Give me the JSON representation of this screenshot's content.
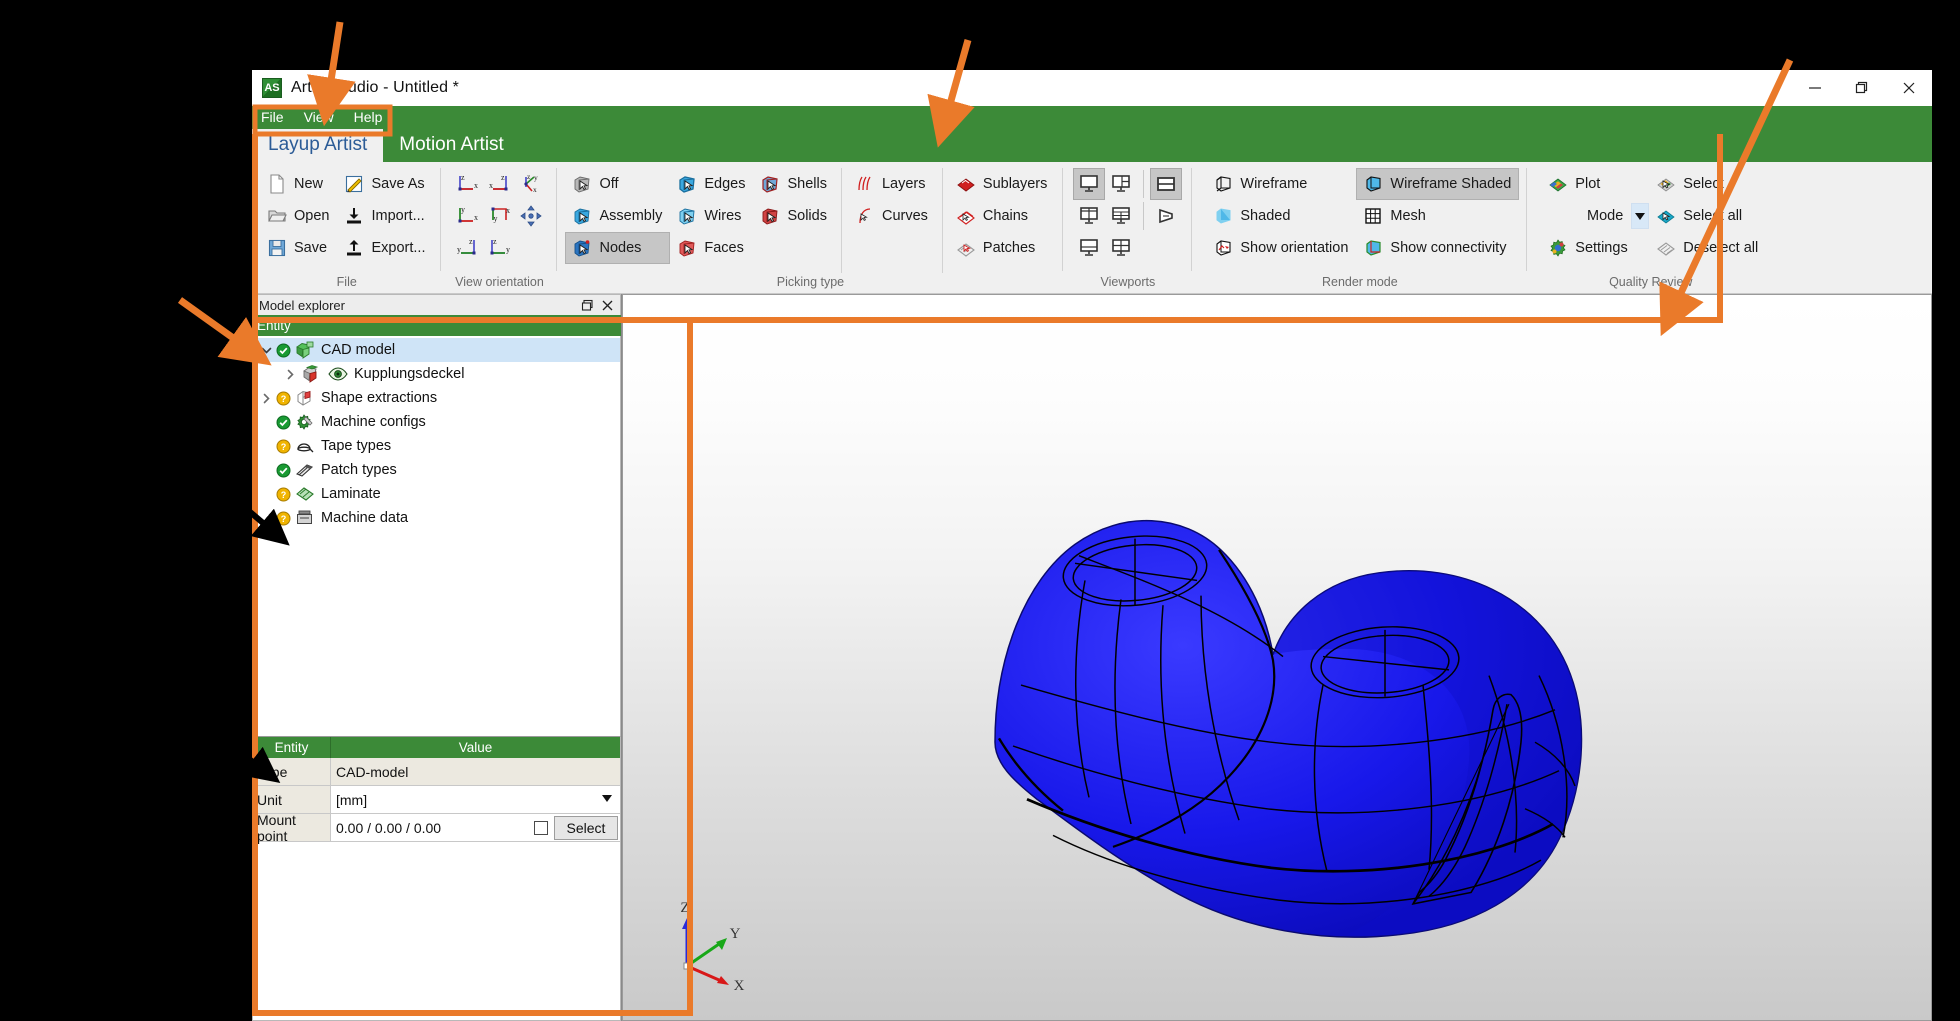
{
  "window": {
    "title": "Artist Studio - Untitled *",
    "logo_text": "AS",
    "controls": {
      "minimize": "minimize-icon",
      "restore": "restore-icon",
      "close": "close-icon"
    }
  },
  "menubar": {
    "items": [
      "File",
      "View",
      "Help"
    ]
  },
  "tabs": [
    {
      "label": "Layup Artist",
      "active": true
    },
    {
      "label": "Motion Artist",
      "active": false
    }
  ],
  "ribbon": {
    "groups": [
      {
        "name": "File",
        "label": "File",
        "columns": [
          {
            "items": [
              {
                "label": "New",
                "icon": "new-document-icon",
                "selected": false
              },
              {
                "label": "Open",
                "icon": "open-folder-icon",
                "selected": false
              },
              {
                "label": "Save",
                "icon": "save-disk-icon",
                "selected": false
              }
            ]
          },
          {
            "items": [
              {
                "label": "Save As",
                "icon": "save-as-icon",
                "selected": false
              },
              {
                "label": "Import...",
                "icon": "import-icon",
                "selected": false
              },
              {
                "label": "Export...",
                "icon": "export-icon",
                "selected": false
              }
            ]
          }
        ]
      },
      {
        "name": "View orientation",
        "label": "View orientation",
        "buttons": [
          [
            "view-zx-icon",
            "view-xz-icon",
            "view-zyx-iso-icon"
          ],
          [
            "view-yx-icon",
            "view-yx-alt-icon",
            "view-fit-move-icon"
          ],
          [
            "view-yz-icon",
            "view-zy-icon",
            null
          ]
        ]
      },
      {
        "name": "Picking type",
        "label": "Picking type",
        "columns": [
          {
            "items": [
              {
                "label": "Off",
                "icon": "pick-off-icon",
                "selected": false
              },
              {
                "label": "Assembly",
                "icon": "pick-assembly-icon",
                "selected": false
              },
              {
                "label": "Nodes",
                "icon": "pick-nodes-icon",
                "selected": true
              }
            ]
          },
          {
            "items": [
              {
                "label": "Edges",
                "icon": "pick-edges-icon",
                "selected": false
              },
              {
                "label": "Wires",
                "icon": "pick-wires-icon",
                "selected": false
              },
              {
                "label": "Faces",
                "icon": "pick-faces-icon",
                "selected": false
              }
            ]
          },
          {
            "items": [
              {
                "label": "Shells",
                "icon": "pick-shells-icon",
                "selected": false
              },
              {
                "label": "Solids",
                "icon": "pick-solids-icon",
                "selected": false
              }
            ]
          },
          {
            "items": [
              {
                "label": "Layers",
                "icon": "layers-icon",
                "selected": false
              },
              {
                "label": "Curves",
                "icon": "curves-icon",
                "selected": false
              }
            ]
          },
          {
            "items": [
              {
                "label": "Sublayers",
                "icon": "sublayers-icon",
                "selected": false
              },
              {
                "label": "Chains",
                "icon": "chains-icon",
                "selected": false
              },
              {
                "label": "Patches",
                "icon": "patches-icon",
                "selected": false
              }
            ]
          }
        ]
      },
      {
        "name": "Viewports",
        "label": "Viewports",
        "buttons": [
          [
            "viewport-single-icon",
            "viewport-2-right-split-icon",
            "viewport-horizontal-split-icon"
          ],
          [
            "viewport-2-top-split-icon",
            "viewport-3-mixed-icon",
            "viewport-perspective-icon"
          ],
          [
            "viewport-2-bottom-split-icon",
            "viewport-quad-icon",
            null
          ]
        ],
        "selected": [
          "viewport-single-icon",
          "viewport-horizontal-split-icon"
        ]
      },
      {
        "name": "Render mode",
        "label": "Render mode",
        "columns": [
          {
            "items": [
              {
                "label": "Wireframe",
                "icon": "wireframe-icon",
                "selected": false
              },
              {
                "label": "Shaded",
                "icon": "shaded-icon",
                "selected": false
              },
              {
                "label": "Show orientation",
                "icon": "show-orientation-icon",
                "selected": false
              }
            ]
          },
          {
            "items": [
              {
                "label": "Wireframe Shaded",
                "icon": "wireframe-shaded-icon",
                "selected": true
              },
              {
                "label": "Mesh",
                "icon": "mesh-icon",
                "selected": false
              },
              {
                "label": "Show connectivity",
                "icon": "show-connectivity-icon",
                "selected": false
              }
            ]
          }
        ]
      },
      {
        "name": "Quality Review",
        "label": "Quality Review",
        "columns": [
          {
            "items": [
              {
                "label": "Plot",
                "icon": "plot-icon",
                "selected": false
              },
              {
                "label": "Mode",
                "icon": "mode-dropdown-icon",
                "selected": false,
                "is_dropdown": true
              },
              {
                "label": "Settings",
                "icon": "settings-icon",
                "selected": false
              }
            ]
          },
          {
            "items": [
              {
                "label": "Select",
                "icon": "qr-select-icon",
                "selected": false
              },
              {
                "label": "Select all",
                "icon": "qr-select-all-icon",
                "selected": false
              },
              {
                "label": "Deselect all",
                "icon": "qr-deselect-all-icon",
                "selected": false
              }
            ]
          }
        ]
      }
    ]
  },
  "model_explorer": {
    "panel_title": "Model explorer",
    "tree_header": "Entity",
    "nodes": [
      {
        "label": "CAD model",
        "depth": 0,
        "twisty": "expanded",
        "status": "ok",
        "icon": "cad-model-icon",
        "eye": false,
        "selected": true
      },
      {
        "label": "Kupplungsdeckel",
        "depth": 1,
        "twisty": "collapsed",
        "status": "none",
        "icon": "part-icon",
        "eye": true,
        "selected": false
      },
      {
        "label": "Shape extractions",
        "depth": 0,
        "twisty": "collapsed",
        "status": "warn",
        "icon": "shape-extraction-icon",
        "eye": false,
        "selected": false
      },
      {
        "label": "Machine configs",
        "depth": 0,
        "twisty": "none",
        "status": "ok",
        "icon": "machine-config-icon",
        "eye": false,
        "selected": false
      },
      {
        "label": "Tape types",
        "depth": 0,
        "twisty": "none",
        "status": "warn",
        "icon": "tape-type-icon",
        "eye": false,
        "selected": false
      },
      {
        "label": "Patch types",
        "depth": 0,
        "twisty": "none",
        "status": "ok",
        "icon": "patch-type-icon",
        "eye": false,
        "selected": false
      },
      {
        "label": "Laminate",
        "depth": 0,
        "twisty": "none",
        "status": "warn",
        "icon": "laminate-icon",
        "eye": false,
        "selected": false
      },
      {
        "label": "Machine data",
        "depth": 0,
        "twisty": "none",
        "status": "warn",
        "icon": "machine-data-icon",
        "eye": false,
        "selected": false
      }
    ]
  },
  "properties": {
    "headers": [
      "Entity",
      "Value"
    ],
    "rows": [
      {
        "key": "Type",
        "value": "CAD-model",
        "control": "text"
      },
      {
        "key": "Unit",
        "value": "[mm]",
        "control": "dropdown"
      },
      {
        "key": "Mount point",
        "value": "0.00 / 0.00 / 0.00",
        "control": "point",
        "checked": false,
        "button_label": "Select"
      }
    ]
  },
  "viewport": {
    "axes": {
      "x": "X",
      "y": "Y",
      "z": "Z"
    },
    "model_color": "#1414e6",
    "background_top": "#ffffff",
    "background_bottom": "#c9c9c9"
  },
  "annotations": {
    "color": "#ea7a2a",
    "highlight_boxes": [
      "menubar-box",
      "ribbon-box",
      "model-explorer-box"
    ],
    "arrows": [
      "arrow-to-menubar",
      "arrow-to-ribbon-left",
      "arrow-to-ribbon-right",
      "arrow-to-model-explorer",
      "arrow-to-patch-types",
      "arrow-to-unit-row"
    ]
  }
}
